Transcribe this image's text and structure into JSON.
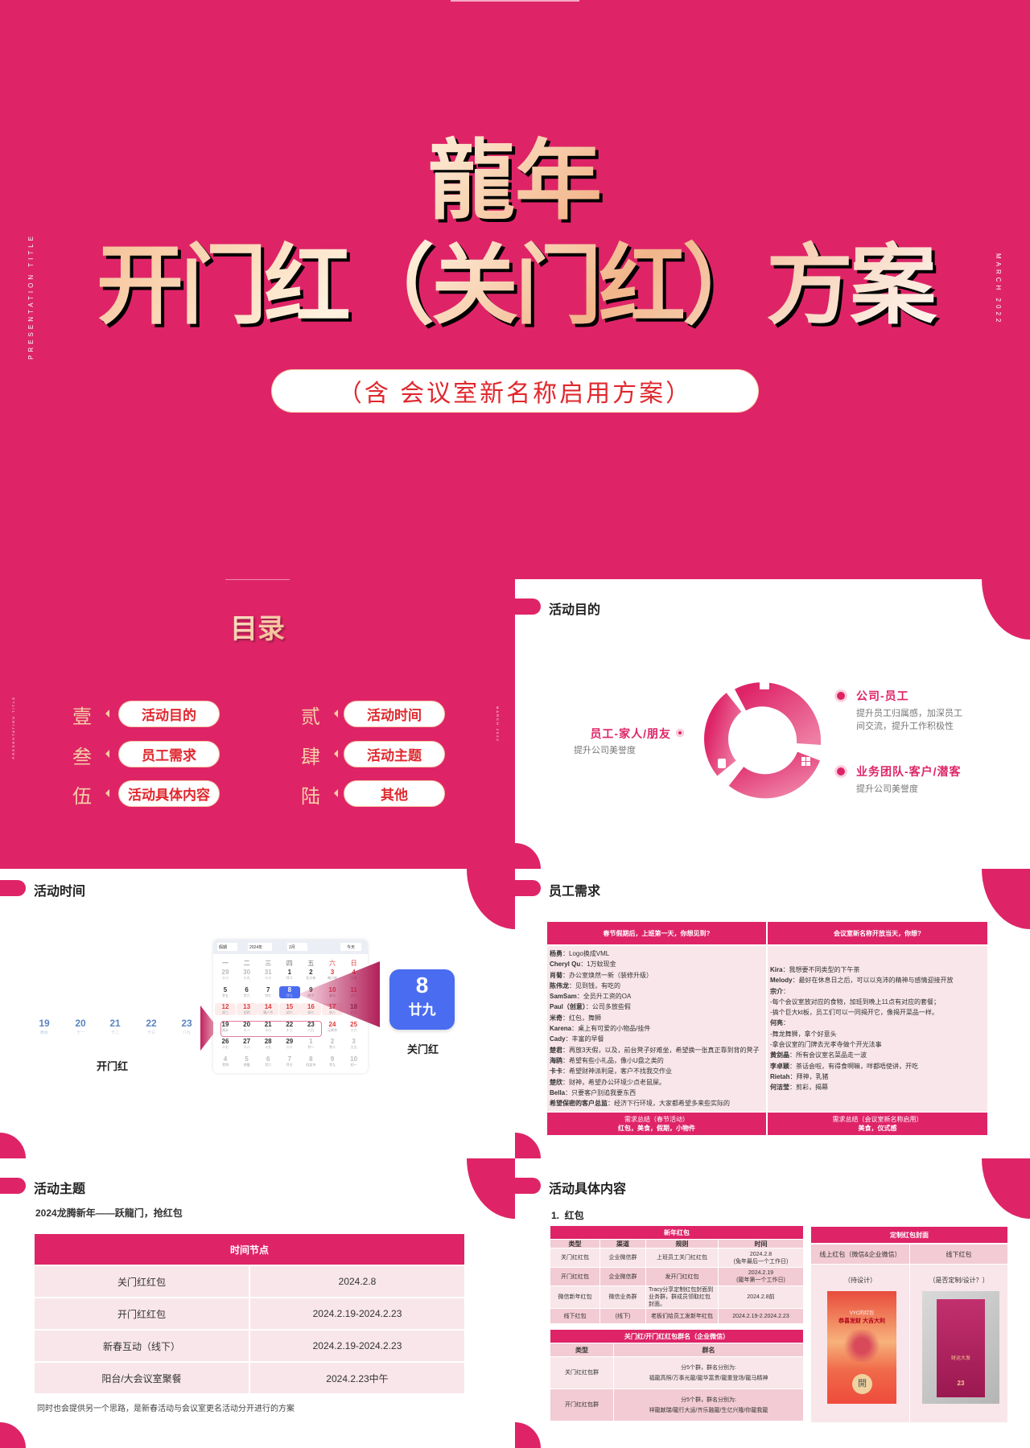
{
  "colors": {
    "brand": "#DE2467",
    "gold": "#F4B98A",
    "blue": "#4A6CF0",
    "red_text": "#E0282E"
  },
  "cover": {
    "title_line1": "龍年",
    "title_line2": "开门红（关门红）方案",
    "subtitle": "（含  会议室新名称启用方案）",
    "side_left": "PRESENTATION TITLE",
    "side_right": "MARCH 2022"
  },
  "toc": {
    "title": "目录",
    "side_left": "PRESENTATION TITLE",
    "side_right": "MARCH 2022",
    "items": [
      {
        "num": "壹",
        "label": "活动目的"
      },
      {
        "num": "贰",
        "label": "活动时间"
      },
      {
        "num": "叁",
        "label": "员工需求"
      },
      {
        "num": "肆",
        "label": "活动主题"
      },
      {
        "num": "伍",
        "label": "活动具体内容"
      },
      {
        "num": "陆",
        "label": "其他"
      }
    ]
  },
  "purpose": {
    "title": "活动目的",
    "left": {
      "heading": "员工-家人/朋友",
      "desc": "提升公司美誉度"
    },
    "right_top": {
      "heading": "公司-员工",
      "desc1": "提升员工归属感，加深员工",
      "desc2": "间交流，提升工作积极性"
    },
    "right_bottom": {
      "heading": "业务团队-客户/潜客",
      "desc": "提升公司美誉度"
    },
    "icons": [
      "chart-board-icon",
      "phone-icon",
      "gift-icon"
    ]
  },
  "timing": {
    "title": "活动时间",
    "days": [
      {
        "day": "19",
        "lunar": "雨水"
      },
      {
        "day": "20",
        "lunar": "十一"
      },
      {
        "day": "21",
        "lunar": "十二"
      },
      {
        "day": "22",
        "lunar": "十三"
      },
      {
        "day": "23",
        "lunar": "八九"
      }
    ],
    "open_label": "开门红",
    "close_label": "关门红",
    "highlight": {
      "day": "8",
      "lunar": "廿九"
    },
    "calendar": {
      "holiday_select": "假期",
      "year_select": "2024年",
      "month_select": "2月",
      "today_button": "今天",
      "weekdays": [
        "一",
        "二",
        "三",
        "四",
        "五",
        "六",
        "日"
      ],
      "weeks": [
        [
          {
            "d": "29",
            "l": "十八",
            "o": true
          },
          {
            "d": "30",
            "l": "十九",
            "o": true
          },
          {
            "d": "31",
            "l": "二十",
            "o": true
          },
          {
            "d": "1",
            "l": "廿二"
          },
          {
            "d": "2",
            "l": "北小年"
          },
          {
            "d": "3",
            "l": "南小年",
            "r": true
          },
          {
            "d": "4",
            "l": "立春",
            "r": true
          }
        ],
        [
          {
            "d": "5",
            "l": "廿五"
          },
          {
            "d": "6",
            "l": "廿六"
          },
          {
            "d": "7",
            "l": "廿七"
          },
          {
            "d": "8",
            "l": "廿九",
            "sel": true
          },
          {
            "d": "9",
            "l": "除夕"
          },
          {
            "d": "10",
            "l": "春节",
            "r": true
          },
          {
            "d": "11",
            "l": "初二",
            "r": true
          }
        ],
        [
          {
            "d": "12",
            "l": "初三",
            "r": true
          },
          {
            "d": "13",
            "l": "初四",
            "r": true
          },
          {
            "d": "14",
            "l": "情人节",
            "r": true
          },
          {
            "d": "15",
            "l": "初六",
            "r": true
          },
          {
            "d": "16",
            "l": "初七",
            "r": true
          },
          {
            "d": "17",
            "l": "初八",
            "r": true
          },
          {
            "d": "18",
            "l": "初九"
          }
        ],
        [
          {
            "d": "19",
            "l": "雨水"
          },
          {
            "d": "20",
            "l": "十一"
          },
          {
            "d": "21",
            "l": "十二"
          },
          {
            "d": "22",
            "l": "十三"
          },
          {
            "d": "23",
            "l": "八九"
          },
          {
            "d": "24",
            "l": "元宵节",
            "r": true
          },
          {
            "d": "25",
            "l": "十六",
            "r": true
          }
        ],
        [
          {
            "d": "26",
            "l": "十七"
          },
          {
            "d": "27",
            "l": "十八"
          },
          {
            "d": "28",
            "l": "十九"
          },
          {
            "d": "29",
            "l": "二十"
          },
          {
            "d": "1",
            "l": "廿一",
            "o": true
          },
          {
            "d": "2",
            "l": "廿二",
            "o": true,
            "r": true
          },
          {
            "d": "3",
            "l": "九九",
            "o": true,
            "r": true
          }
        ],
        [
          {
            "d": "4",
            "l": "廿四",
            "o": true
          },
          {
            "d": "5",
            "l": "惊蛰",
            "o": true
          },
          {
            "d": "6",
            "l": "廿六",
            "o": true
          },
          {
            "d": "7",
            "l": "廿七",
            "o": true
          },
          {
            "d": "8",
            "l": "妇女节",
            "o": true
          },
          {
            "d": "9",
            "l": "廿九",
            "o": true,
            "r": true
          },
          {
            "d": "10",
            "l": "初一",
            "o": true,
            "r": true
          }
        ]
      ]
    }
  },
  "needs": {
    "title": "员工需求",
    "col1_header": "春节假期后，上班第一天，你想见到?",
    "col2_header": "会议室新名称开放当天，你想?",
    "col1_lines": [
      {
        "name": "杨勇",
        "text": "：Logo换成VML"
      },
      {
        "name": "Cheryl Qu",
        "text": "：1万蚊现金"
      },
      {
        "name": "肖菊",
        "text": "：办公室焕然一新（装修升级）"
      },
      {
        "name": "陈伟龙",
        "text": "：见到钱，有吃的"
      },
      {
        "name": "SamSam",
        "text": "：全员升工资的OA"
      },
      {
        "name": "Paul（创意）",
        "text": "：公司多放些假"
      },
      {
        "name": "米奇",
        "text": "：红包，舞狮"
      },
      {
        "name": "Karena",
        "text": "：桌上有可爱的小物品/挂件"
      },
      {
        "name": "Cady",
        "text": "：丰富的早餐"
      },
      {
        "name": "楚君",
        "text": "：再放3天假，以及，前台凳子好难坐，希望换一张真正靠到背的凳子"
      },
      {
        "name": "海鸥",
        "text": "：希望有些小礼品，像小U盘之类的"
      },
      {
        "name": "卡卡",
        "text": "：希望财神派利是，客户不找我交作业"
      },
      {
        "name": "楚欣",
        "text": "：财神，希望办公环境少点老鼠屎。"
      },
      {
        "name": "Bella",
        "text": "：只要客户别追我要东西"
      },
      {
        "name": "希望保密的客户总监",
        "text": "：经济下行环境，大家都希望多来些实际的"
      }
    ],
    "col2_lines": [
      {
        "name": "Kira",
        "text": "：我想要不同类型的下午茶"
      },
      {
        "name": "Melody",
        "text": "：最好在休息日之后，可以以充沛的精神与感情迎接开放"
      },
      {
        "name": "宗介",
        "text": "："
      },
      {
        "name": "",
        "text": "-每个会议室放对应的食物，加班到晚上11点有对应的套餐；"
      },
      {
        "name": "",
        "text": "-搞个巨大kt板，员工们可以一同揭开它，像揭开菜品一样。"
      },
      {
        "name": "何亮",
        "text": "："
      },
      {
        "name": "",
        "text": "-舞龙舞狮，拿个好意头"
      },
      {
        "name": "",
        "text": "-拿会议室的门牌去光孝寺做个开光法事"
      },
      {
        "name": "黄剑晶",
        "text": "：所有会议室名菜品走一波"
      },
      {
        "name": "李卓颖",
        "text": "：茶话会啦，有得食啊嘛，咩都唔使讲，开吃"
      },
      {
        "name": "Rietah",
        "text": "：拜神，乳猪"
      },
      {
        "name": "何洁莹",
        "text": "：剪彩，揭幕"
      }
    ],
    "col1_footer_title": "需求总结（春节活动）",
    "col1_footer_value": "红包，美食，假期，小物件",
    "col2_footer_title": "需求总结（会议室新名称启用）",
    "col2_footer_value": "美食，仪式感"
  },
  "theme": {
    "title": "活动主题",
    "subtitle": "2024龙腾新年——跃龍门，抢红包",
    "table_header": "时间节点",
    "rows": [
      {
        "item": "关门红红包",
        "date": "2024.2.8"
      },
      {
        "item": "开门红红包",
        "date": "2024.2.19-2024.2.23"
      },
      {
        "item": "新春互动（线下）",
        "date": "2024.2.19-2024.2.23"
      },
      {
        "item": "阳台/大会议室聚餐",
        "date": "2024.2.23中午"
      }
    ],
    "note": "同时也会提供另一个思路，是新春活动与会议室更名活动分开进行的方案"
  },
  "details": {
    "title": "活动具体内容",
    "section": "1.  红包",
    "table1": {
      "title": "新年红包",
      "headers": [
        "类型",
        "渠道",
        "规则",
        "时间"
      ],
      "rows": [
        [
          "关门红红包",
          "企业微信群",
          "上班员工关门红红包",
          "2024.2.8\n(兔年最后一个工作日)"
        ],
        [
          "开门红红包",
          "企业微信群",
          "发开门红红包",
          "2024.2.19\n(龍年第一个工作日)"
        ],
        [
          "微信新年红包",
          "微信业务群",
          "Tracy分享定制红包封面到业务群，群成员领取红包封面。",
          "2024.2.8前"
        ],
        [
          "线下红包",
          "(线下)",
          "老板们给员工发新年红包",
          "2024.2.19-2.2024.2.23"
        ]
      ]
    },
    "table2": {
      "title": "关门红/开门红红包群名（企业微信）",
      "headers": [
        "类型",
        "群名"
      ],
      "rows": [
        [
          "关门红红包群",
          "分5个群，群名分别为:\n福龍高照/万事光龍/龍华富贵/龍重登场/龍马精神"
        ],
        [
          "开门红红包群",
          "分5个群，群名分别为:\n祥龍献瑞/龍行大运/齐乐融龍/生亿兴隆/你龍我龍"
        ]
      ]
    },
    "table3": {
      "title": "定制红包封面",
      "headers": [
        "线上红包（微信&企业微信）",
        "线下红包"
      ],
      "notes": [
        "（待设计）",
        "（是否定制/设计？）"
      ],
      "cover1": {
        "brand": "VYC的红包",
        "slogan": "恭喜发财 大吉大利",
        "open": "開"
      },
      "cover2": {
        "text": "财运大发",
        "year": "23"
      }
    }
  }
}
